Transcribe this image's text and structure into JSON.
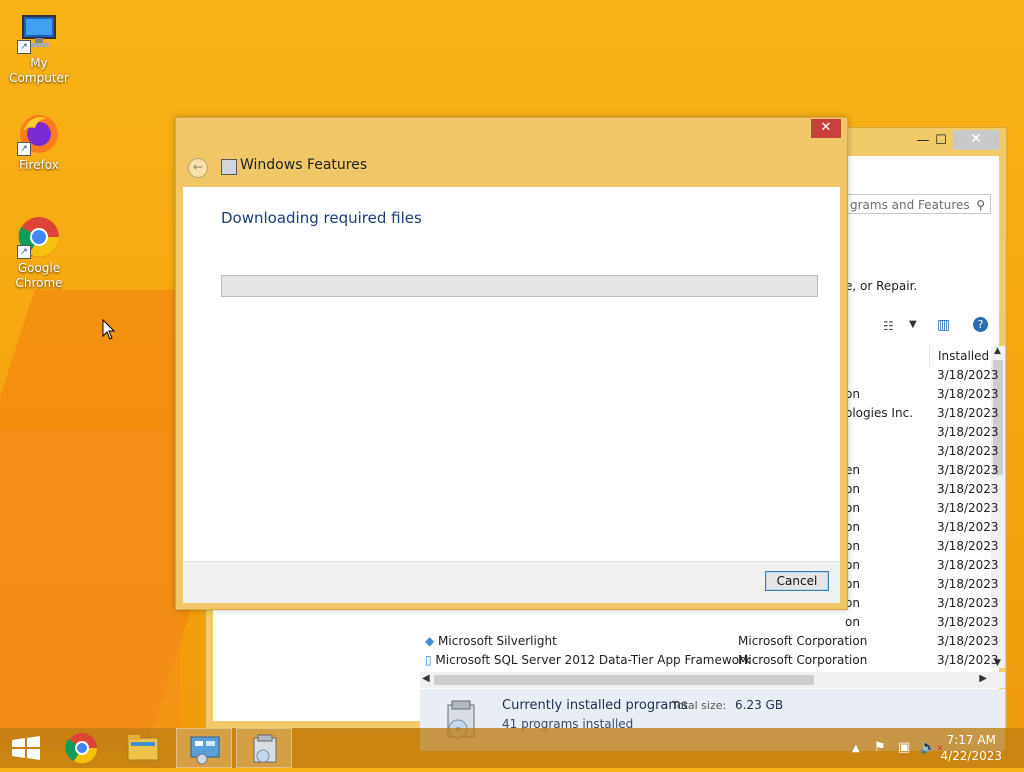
{
  "desktop": {
    "icons": [
      {
        "label": "My Computer",
        "icon": "computer-icon"
      },
      {
        "label": "Firefox",
        "icon": "firefox-icon"
      },
      {
        "label": "Google Chrome",
        "icon": "chrome-icon"
      }
    ]
  },
  "back_window": {
    "title_partial": "",
    "search_placeholder": "grams and Features",
    "repair_text": "e, or Repair.",
    "column_installed": "Installed C",
    "rows": [
      {
        "name": "",
        "publisher": "",
        "date": "3/18/2023"
      },
      {
        "name": "",
        "publisher": "on",
        "date": "3/18/2023"
      },
      {
        "name": "",
        "publisher": "ologies Inc.",
        "date": "3/18/2023"
      },
      {
        "name": "",
        "publisher": "",
        "date": "3/18/2023"
      },
      {
        "name": "",
        "publisher": "",
        "date": "3/18/2023"
      },
      {
        "name": "",
        "publisher": "en",
        "date": "3/18/2023"
      },
      {
        "name": "",
        "publisher": "on",
        "date": "3/18/2023"
      },
      {
        "name": "",
        "publisher": "on",
        "date": "3/18/2023"
      },
      {
        "name": "",
        "publisher": "on",
        "date": "3/18/2023"
      },
      {
        "name": "",
        "publisher": "on",
        "date": "3/18/2023"
      },
      {
        "name": "",
        "publisher": "on",
        "date": "3/18/2023"
      },
      {
        "name": "",
        "publisher": "on",
        "date": "3/18/2023"
      },
      {
        "name": "",
        "publisher": "on",
        "date": "3/18/2023"
      },
      {
        "name": "",
        "publisher": "on",
        "date": "3/18/2023"
      },
      {
        "name": "Microsoft Silverlight",
        "publisher": "Microsoft Corporation",
        "date": "3/18/2023"
      },
      {
        "name": "Microsoft SQL Server 2012 Data-Tier App Framework",
        "publisher": "Microsoft Corporation",
        "date": "3/18/2023"
      }
    ],
    "status": {
      "title": "Currently installed programs",
      "total_size_label": "Total size:",
      "total_size_value": "6.23 GB",
      "count_text": "41 programs installed"
    }
  },
  "dialog": {
    "title": "Windows Features",
    "heading": "Downloading required files",
    "progress_fraction": 0,
    "cancel_label": "Cancel",
    "close_glyph": "✕"
  },
  "taskbar": {
    "time": "7:17 AM",
    "date": "4/22/2023"
  },
  "colors": {
    "accent": "#f5a50f",
    "dialog_frame": "#f2c76a",
    "heading": "#1c3d7a",
    "close_red": "#c7403a"
  }
}
